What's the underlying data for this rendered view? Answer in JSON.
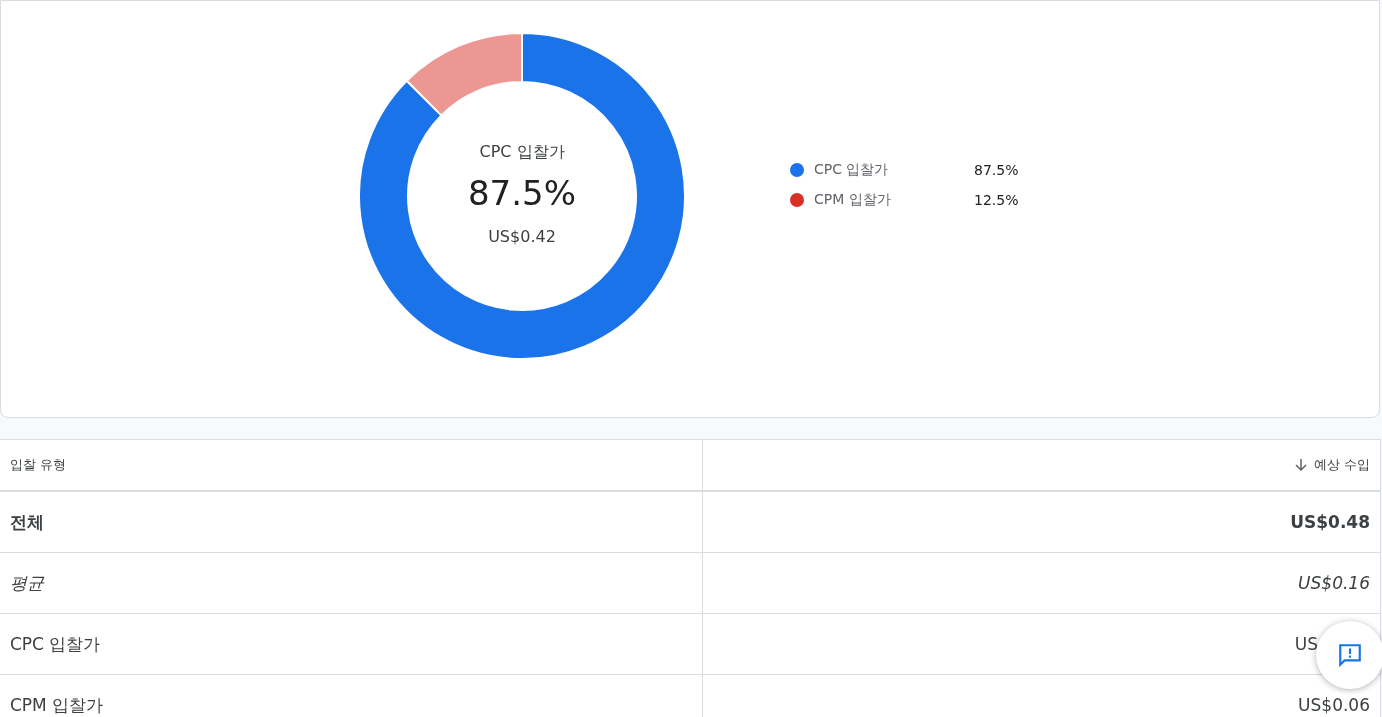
{
  "chart": {
    "center": {
      "label": "CPC 입찰가",
      "percent": "87.5%",
      "amount": "US$0.42"
    },
    "legend": [
      {
        "value": "87.5%",
        "color": "#1a73e8",
        "selected": true
      },
      {
        "value": "12.5%",
        "color": "#d93025",
        "selected": false
      }
    ],
    "chart_data": {
      "type": "donut",
      "categories": [
        "CPC 입찰가",
        "CPM 입찰가"
      ],
      "values": [
        87.5,
        12.5
      ]
    }
  },
  "table": {
    "columns": [
      {
        "label": "입찰 유형",
        "sorted": false
      },
      {
        "label": "예상 수입",
        "sorted": true
      }
    ],
    "rows": [
      {
        "kind": "total",
        "cells": [
          "전체",
          "US$0.48"
        ]
      },
      {
        "kind": "average",
        "cells": [
          "평균",
          "US$0.16"
        ]
      },
      {
        "kind": "normal",
        "cells": [
          "CPC 입찰가",
          "US"
        ],
        "obscured": true
      },
      {
        "kind": "normal",
        "cells": [
          "CPM 입찰가",
          "US$0.06"
        ]
      }
    ]
  }
}
